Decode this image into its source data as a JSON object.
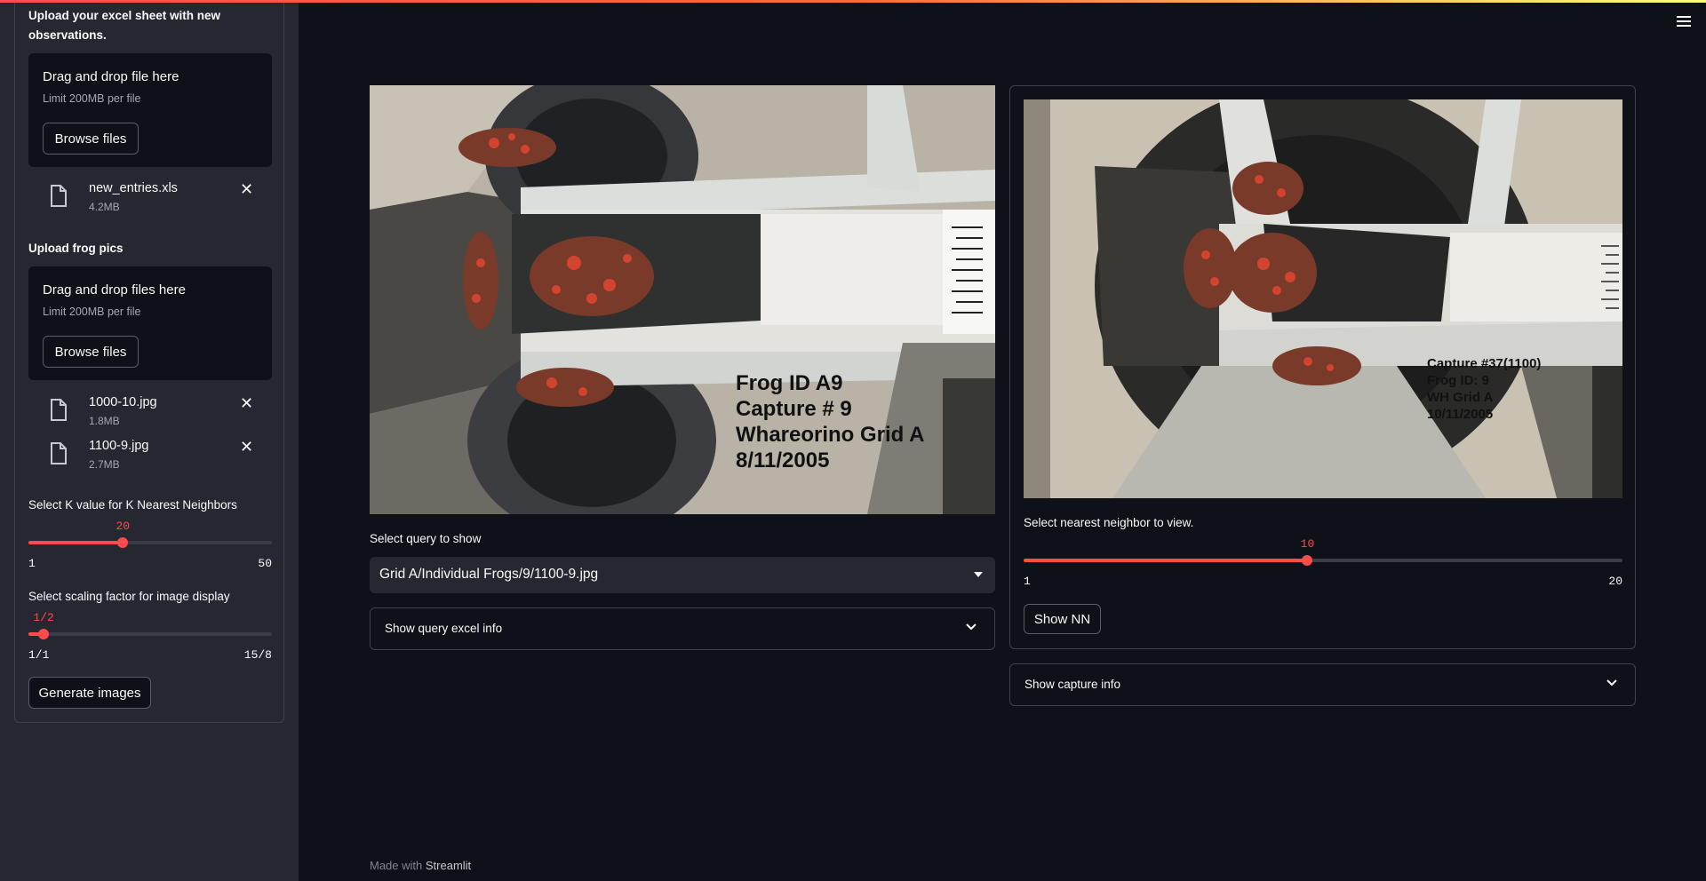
{
  "sidebar": {
    "excel_upload": {
      "label": "Upload your excel sheet with new observations.",
      "drop_title": "Drag and drop file here",
      "limit": "Limit 200MB per file",
      "browse_label": "Browse files",
      "files": [
        {
          "name": "new_entries.xls",
          "size": "4.2MB"
        }
      ]
    },
    "pics_upload": {
      "label": "Upload frog pics",
      "drop_title": "Drag and drop files here",
      "limit": "Limit 200MB per file",
      "browse_label": "Browse files",
      "files": [
        {
          "name": "1000-10.jpg",
          "size": "1.8MB"
        },
        {
          "name": "1100-9.jpg",
          "size": "2.7MB"
        }
      ]
    },
    "k_slider": {
      "label": "Select K value for K Nearest Neighbors",
      "value": "20",
      "min": "1",
      "max": "50",
      "fraction": 0.388
    },
    "scale_slider": {
      "label": "Select scaling factor for image display",
      "value": "1/2",
      "min": "1/1",
      "max": "15/8",
      "fraction": 0.0625
    },
    "generate_label": "Generate images"
  },
  "query": {
    "image_text": [
      "Frog ID A9",
      "Capture # 9",
      "Whareorino Grid A",
      "8/11/2005"
    ],
    "select_label": "Select query to show",
    "select_value": "Grid A/Individual Frogs/9/1100-9.jpg",
    "expander_label": "Show query excel info"
  },
  "neighbor": {
    "image_text": [
      "Capture #37(1100)",
      "Frog ID: 9",
      "WH Grid A",
      "10/11/2005"
    ],
    "slider": {
      "label": "Select nearest neighbor to view.",
      "value": "10",
      "min": "1",
      "max": "20",
      "fraction": 0.474
    },
    "show_nn_label": "Show NN",
    "expander_label": "Show capture info"
  },
  "footer": {
    "prefix": "Made with",
    "brand": "Streamlit"
  },
  "colors": {
    "accent": "#ff4b4b",
    "background": "#0e1117",
    "sidebar": "#262730"
  }
}
